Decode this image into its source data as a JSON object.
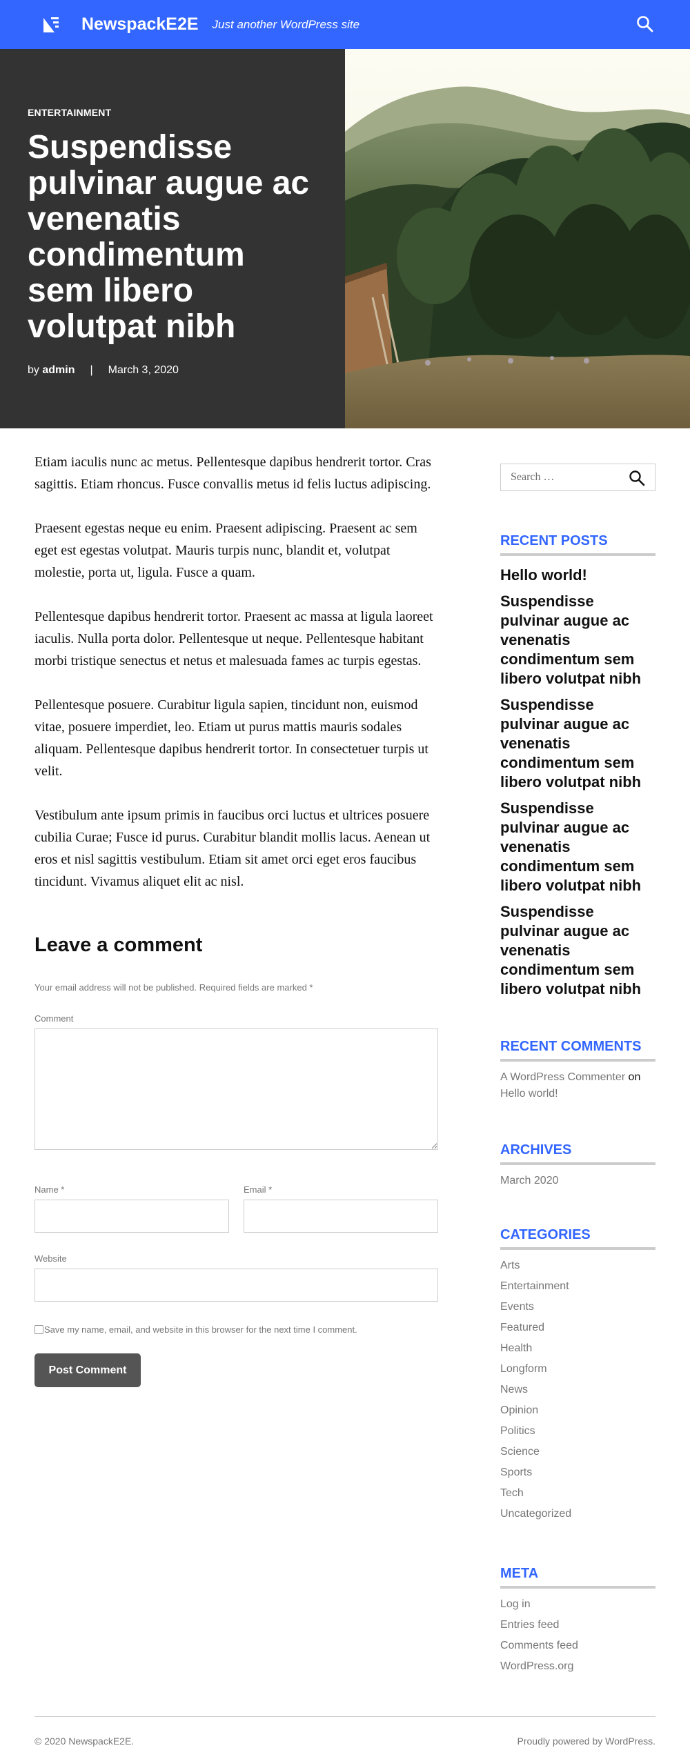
{
  "header": {
    "site_title": "NewspackE2E",
    "tagline": "Just another WordPress site",
    "brand_color": "#3366ff",
    "logo_icon": "newspack-logo-icon",
    "search_icon": "search-icon"
  },
  "hero": {
    "category": "ENTERTAINMENT",
    "title": "Suspendisse pulvinar augue ac venenatis condimentum sem libero volutpat nibh",
    "by": "by",
    "author": "admin",
    "separator": "|",
    "date": "March 3, 2020",
    "image": "mountain-forest-cabin-photo"
  },
  "article": {
    "paragraphs": [
      "Etiam iaculis nunc ac metus. Pellentesque dapibus hendrerit tortor. Cras sagittis. Etiam rhoncus. Fusce convallis metus id felis luctus adipiscing.",
      "Praesent egestas neque eu enim. Praesent adipiscing. Praesent ac sem eget est egestas volutpat. Mauris turpis nunc, blandit et, volutpat molestie, porta ut, ligula. Fusce a quam.",
      "Pellentesque dapibus hendrerit tortor. Praesent ac massa at ligula laoreet iaculis. Nulla porta dolor. Pellentesque ut neque. Pellentesque habitant morbi tristique senectus et netus et malesuada fames ac turpis egestas.",
      "Pellentesque posuere. Curabitur ligula sapien, tincidunt non, euismod vitae, posuere imperdiet, leo. Etiam ut purus mattis mauris sodales aliquam. Pellentesque dapibus hendrerit tortor. In consectetuer turpis ut velit.",
      "Vestibulum ante ipsum primis in faucibus orci luctus et ultrices posuere cubilia Curae; Fusce id purus. Curabitur blandit mollis lacus. Aenean ut eros et nisl sagittis vestibulum. Etiam sit amet orci eget eros faucibus tincidunt. Vivamus aliquet elit ac nisl."
    ]
  },
  "comment_form": {
    "title": "Leave a comment",
    "notes": "Your email address will not be published. Required fields are marked *",
    "comment_label": "Comment",
    "name_label": "Name *",
    "email_label": "Email *",
    "website_label": "Website",
    "consent": "Save my name, email, and website in this browser for the next time I comment.",
    "submit": "Post Comment"
  },
  "sidebar": {
    "search_placeholder": "Search …",
    "recent_posts": {
      "title": "RECENT POSTS",
      "items": [
        "Hello world!",
        "Suspendisse pulvinar augue ac venenatis condimentum sem libero volutpat nibh",
        "Suspendisse pulvinar augue ac venenatis condimentum sem libero volutpat nibh",
        "Suspendisse pulvinar augue ac venenatis condimentum sem libero volutpat nibh",
        "Suspendisse pulvinar augue ac venenatis condimentum sem libero volutpat nibh"
      ]
    },
    "recent_comments": {
      "title": "RECENT COMMENTS",
      "author": "A WordPress Commenter",
      "on": "on",
      "post": "Hello world!"
    },
    "archives": {
      "title": "ARCHIVES",
      "items": [
        "March 2020"
      ]
    },
    "categories": {
      "title": "CATEGORIES",
      "items": [
        "Arts",
        "Entertainment",
        "Events",
        "Featured",
        "Health",
        "Longform",
        "News",
        "Opinion",
        "Politics",
        "Science",
        "Sports",
        "Tech",
        "Uncategorized"
      ]
    },
    "meta": {
      "title": "META",
      "items": [
        "Log in",
        "Entries feed",
        "Comments feed",
        "WordPress.org"
      ]
    }
  },
  "footer": {
    "copyright": "© 2020 NewspackE2E.",
    "powered": "Proudly powered by WordPress."
  }
}
